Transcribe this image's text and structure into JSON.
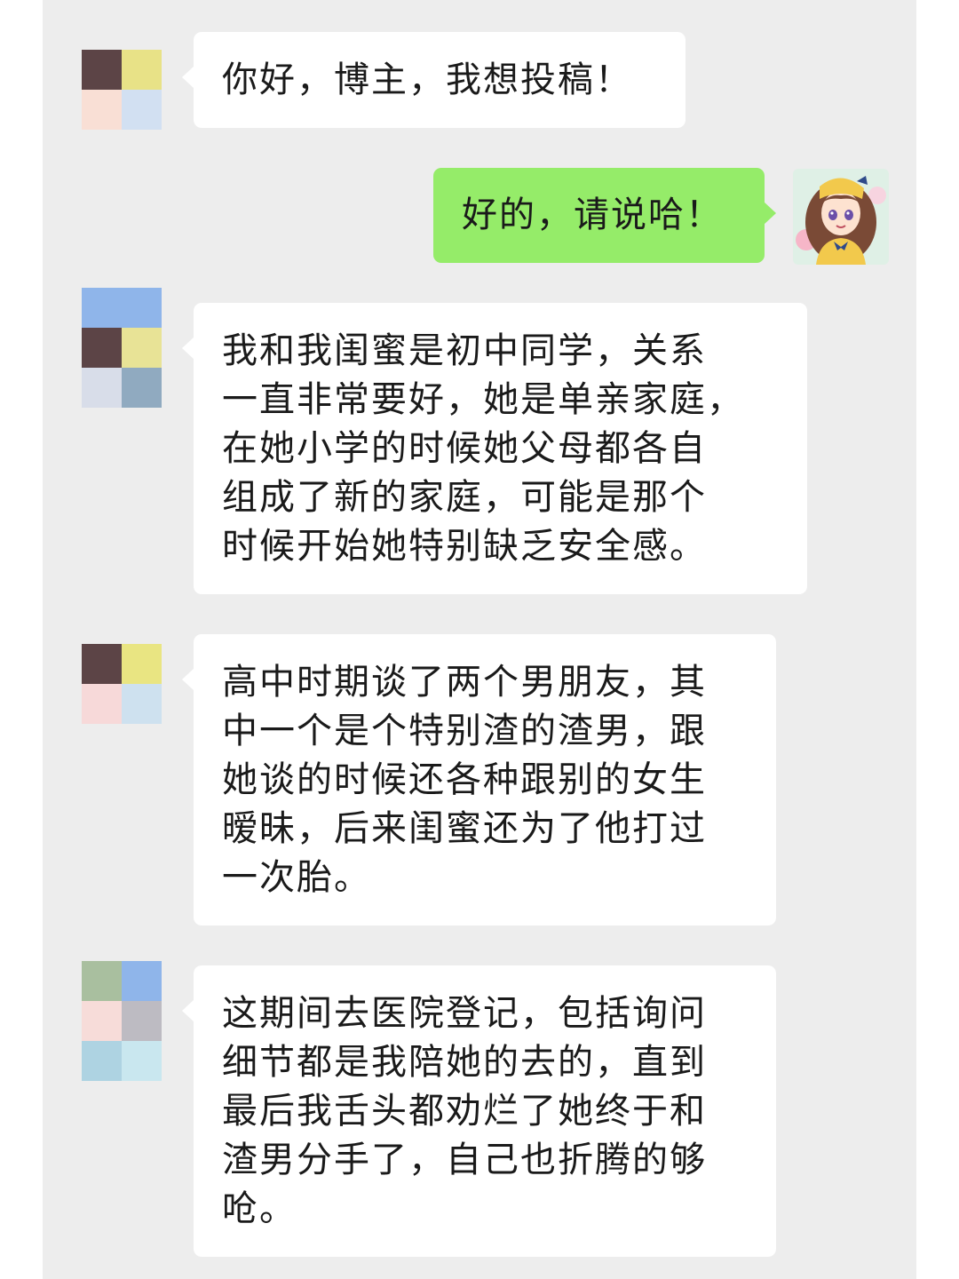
{
  "messages": [
    {
      "sender": "friend",
      "lines": [
        "你好，博主，我想投稿！"
      ]
    },
    {
      "sender": "self",
      "lines": [
        "好的，请说哈！"
      ]
    },
    {
      "sender": "friend",
      "lines": [
        "我和我闺蜜是初中同学，关系",
        "一直非常要好，她是单亲家庭，",
        "在她小学的时候她父母都各自",
        "组成了新的家庭，可能是那个",
        "时候开始她特别缺乏安全感。"
      ]
    },
    {
      "sender": "friend",
      "lines": [
        "高中时期谈了两个男朋友，其",
        "中一个是个特别渣的渣男，跟",
        "她谈的时候还各种跟别的女生",
        "暧昧，后来闺蜜还为了他打过",
        "一次胎。"
      ]
    },
    {
      "sender": "friend",
      "lines": [
        "这期间去医院登记，包括询问",
        "细节都是我陪她的去的，直到",
        "最后我舌头都劝烂了她终于和",
        "渣男分手了，自己也折腾的够",
        "呛。"
      ]
    }
  ],
  "avatars": {
    "friend_1": {
      "tiles": [
        "#5c4446",
        "#e8e287",
        "#f9dfd5",
        "#d2e0f2"
      ]
    },
    "friend_3": {
      "tiles": [
        "#8fb5ea",
        "#8fb5ea",
        "#5c4446",
        "#e8e396",
        "#d8dde9",
        "#90aac0"
      ]
    },
    "friend_4": {
      "tiles": [
        "#5c4446",
        "#e9e582",
        "#f7d9d9",
        "#cee1ef"
      ]
    },
    "friend_5": {
      "tiles": [
        "#a9bf9f",
        "#8fb5ea",
        "#f7dcd9",
        "#bdbbc2",
        "#aed3e2",
        "#c9e7ef"
      ]
    },
    "self": {
      "icon": "anime-girl-avatar-icon"
    }
  },
  "colors": {
    "background": "#ededed",
    "incoming_bubble": "#ffffff",
    "outgoing_bubble": "#95ec69"
  }
}
